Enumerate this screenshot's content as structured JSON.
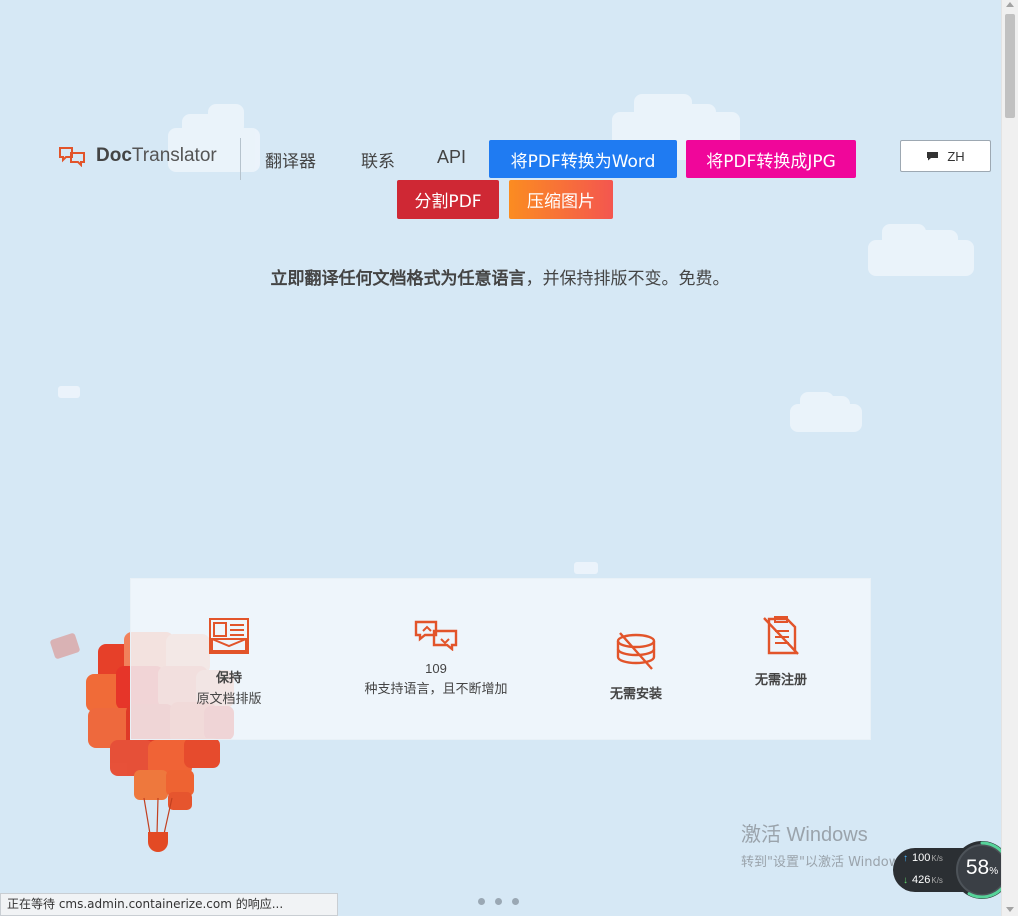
{
  "header": {
    "logo": {
      "bold": "Doc",
      "rest": "Translator",
      "icon": "chat-bubbles-icon"
    },
    "nav": {
      "translator": "翻译器",
      "contact": "联系",
      "api": "API"
    },
    "buttons": {
      "pdf_to_word": "将PDF转换为Word",
      "pdf_to_jpg": "将PDF转换成JPG",
      "split_pdf": "分割PDF",
      "compress_image": "压缩图片"
    },
    "language": {
      "label": "ZH",
      "icon": "chat-icon"
    }
  },
  "tagline": {
    "bold": "立即翻译任何文档格式为任意语言",
    "rest": "，并保持排版不变。免费。"
  },
  "features": [
    {
      "icon": "document-layout-icon",
      "title": "保持",
      "subtitle": "原文档排版"
    },
    {
      "icon": "translate-bubbles-icon",
      "number": "109",
      "subtitle": "种支持语言，且不断增加"
    },
    {
      "icon": "no-install-icon",
      "title": "无需安装"
    },
    {
      "icon": "no-register-icon",
      "title": "无需注册"
    }
  ],
  "windows_activation": {
    "title": "激活 Windows",
    "subtitle": "转到\"设置\"以激活 Windows。"
  },
  "speed_meter": {
    "up_value": "100",
    "up_unit": "K/s",
    "down_value": "426",
    "down_unit": "K/s",
    "percent": "58",
    "percent_sign": "%"
  },
  "status_bar": {
    "text": "正在等待 cms.admin.containerize.com 的响应..."
  },
  "colors": {
    "background": "#d6e8f5",
    "word_button": "#1f7bf2",
    "jpg_button": "#f0069a",
    "split_button": "#cf2834",
    "compress_gradient_start": "#fb8c21",
    "compress_gradient_end": "#f4564f",
    "feature_icon": "#e2542a"
  }
}
